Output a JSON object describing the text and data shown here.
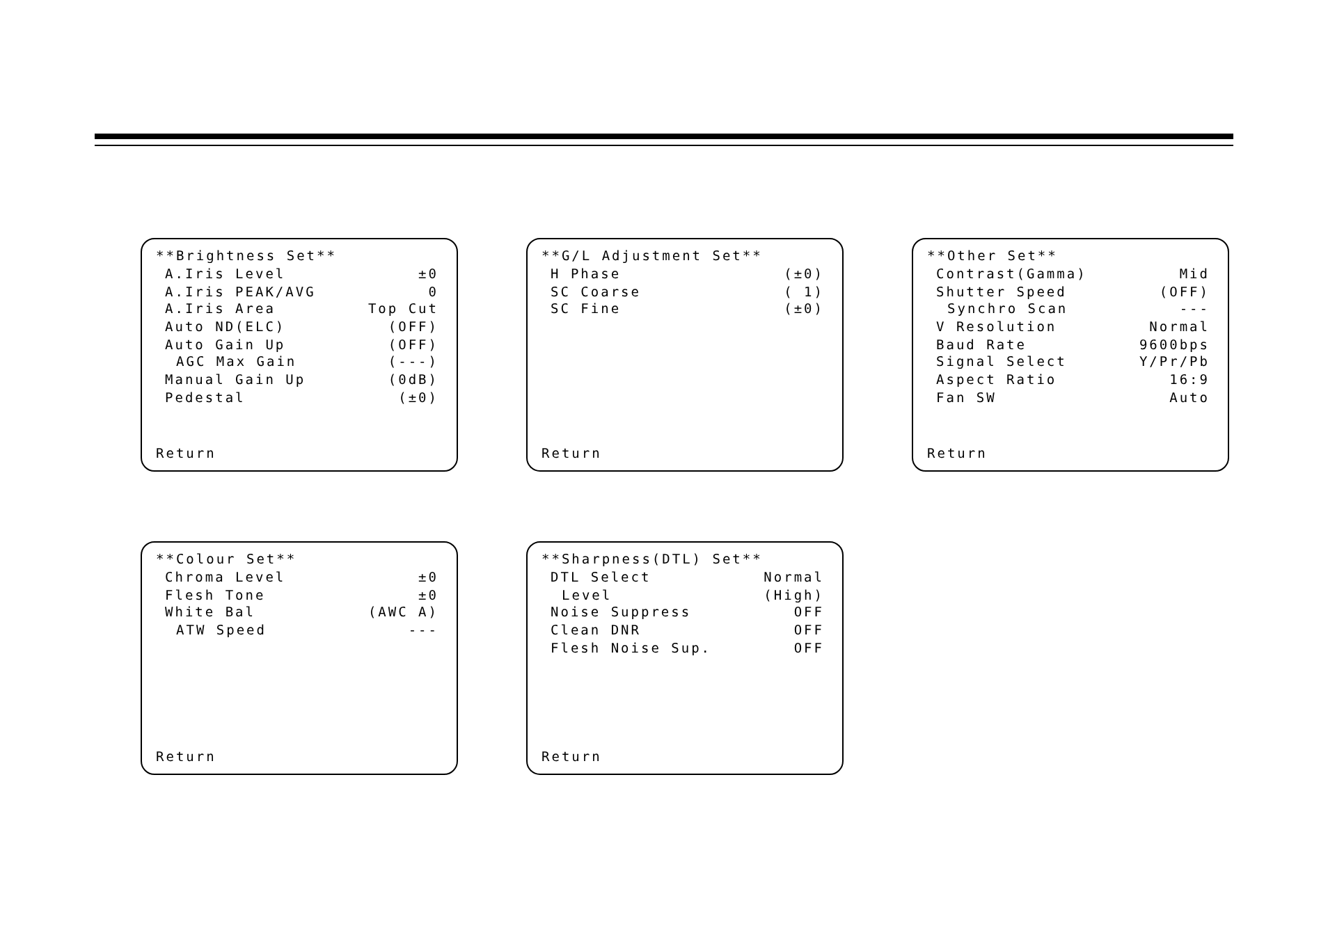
{
  "menus": [
    {
      "title": "**Brightness Set**",
      "items": [
        {
          "label": "A.Iris Level",
          "value": "±0"
        },
        {
          "label": "A.Iris PEAK/AVG",
          "value": "0"
        },
        {
          "label": "A.Iris Area",
          "value": "Top Cut"
        },
        {
          "label": "Auto ND(ELC)",
          "value": "(OFF)"
        },
        {
          "label": "Auto Gain Up",
          "value": "(OFF)",
          "children": [
            {
              "label": "AGC Max Gain",
              "value": "(---)"
            }
          ]
        },
        {
          "label": "Manual Gain Up",
          "value": "(0dB)"
        },
        {
          "label": "Pedestal",
          "value": "(±0)"
        }
      ],
      "return": "Return"
    },
    {
      "title": "**G/L Adjustment Set**",
      "items": [
        {
          "label": "H Phase",
          "value": "(±0)"
        },
        {
          "label": "SC Coarse",
          "value": "( 1)"
        },
        {
          "label": "SC Fine",
          "value": "(±0)"
        }
      ],
      "return": "Return"
    },
    {
      "title": "**Other Set**",
      "items": [
        {
          "label": "Contrast(Gamma)",
          "value": "Mid"
        },
        {
          "label": "Shutter Speed",
          "value": "(OFF)",
          "children": [
            {
              "label": "Synchro Scan",
              "value": "---"
            }
          ]
        },
        {
          "label": "V Resolution",
          "value": "Normal"
        },
        {
          "label": "Baud Rate",
          "value": "9600bps"
        },
        {
          "label": "Signal Select",
          "value": "Y/Pr/Pb"
        },
        {
          "label": "Aspect Ratio",
          "value": "16:9"
        },
        {
          "label": "Fan SW",
          "value": "Auto"
        }
      ],
      "return": "Return"
    },
    {
      "title": "**Colour Set**",
      "items": [
        {
          "label": "Chroma Level",
          "value": "±0"
        },
        {
          "label": "Flesh Tone",
          "value": "±0"
        },
        {
          "label": "White Bal",
          "value": "(AWC A)",
          "children": [
            {
              "label": "ATW Speed",
              "value": "---"
            }
          ]
        }
      ],
      "return": "Return"
    },
    {
      "title": "**Sharpness(DTL) Set**",
      "items": [
        {
          "label": "DTL Select",
          "value": "Normal",
          "children": [
            {
              "label": "Level",
              "value": "(High)"
            }
          ]
        },
        {
          "label": "Noise Suppress",
          "value": "OFF"
        },
        {
          "label": "Clean DNR",
          "value": "OFF"
        },
        {
          "label": "Flesh Noise Sup.",
          "value": "OFF"
        }
      ],
      "return": "Return"
    }
  ]
}
